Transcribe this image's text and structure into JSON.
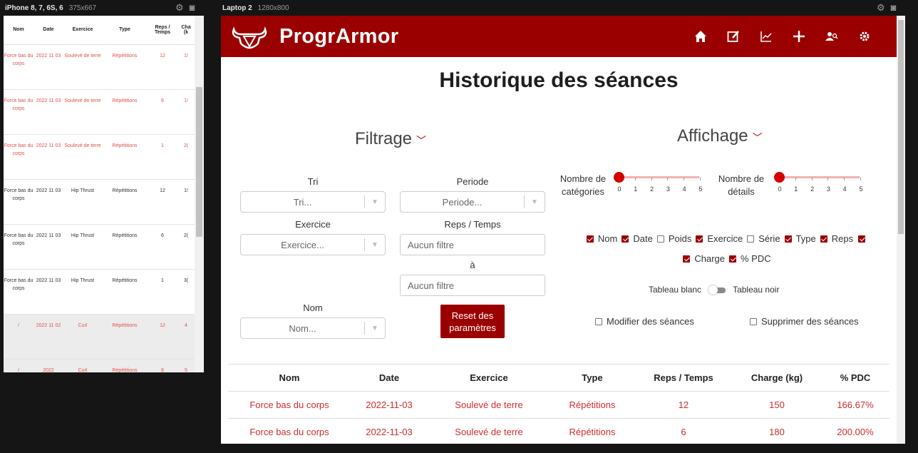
{
  "devtools": {
    "phone_device": "iPhone 8, 7, 6S, 6",
    "phone_size": "375x667",
    "laptop_device": "Laptop 2",
    "laptop_size": "1280x800"
  },
  "phone_table": {
    "headers": [
      "Nom",
      "Date",
      "Exercice",
      "Type",
      "Reps / Temps",
      "Cha (k"
    ],
    "rows": [
      [
        "Force bas du corps",
        "2022 11 03",
        "Soulevé de terre",
        "Répétitions",
        "12",
        "1!"
      ],
      [
        "Force bas du corps",
        "2022 11 03",
        "Soulevé de terre",
        "Répétitions",
        "6",
        "1!"
      ],
      [
        "Force bas du corps",
        "2022 11 03",
        "Soulevé de terre",
        "Répétitions",
        "1",
        "2("
      ],
      [
        "Force bas du corps",
        "2022 11 03",
        "Hip Thrust",
        "Répétitions",
        "12",
        "1!"
      ],
      [
        "Force bas du corps",
        "2022 11 03",
        "Hip Thrust",
        "Répétitions",
        "6",
        "2("
      ],
      [
        "Force bas du corps",
        "2022 11 03",
        "Hip Thrust",
        "Répétitions",
        "1",
        "3("
      ],
      [
        "/",
        "2022 11 02",
        "Curl",
        "Répétitions",
        "12",
        "4"
      ],
      [
        "/",
        "2022",
        "Curl",
        "Répétitions",
        "8",
        "5"
      ]
    ]
  },
  "navbar": {
    "brand": "ProgrArmor",
    "icons": [
      "home-icon",
      "edit-icon",
      "chart-icon",
      "plus-icon",
      "users-icon",
      "gear-icon"
    ]
  },
  "page": {
    "title": "Historique des séances",
    "filtrage": "Filtrage",
    "affichage": "Affichage"
  },
  "filters": {
    "tri_label": "Tri",
    "tri_placeholder": "Tri...",
    "periode_label": "Periode",
    "periode_placeholder": "Periode...",
    "exercice_label": "Exercice",
    "exercice_placeholder": "Exercice...",
    "reps_label": "Reps / Temps",
    "reps_min": "Aucun filtre",
    "a_label": "à",
    "reps_max": "Aucun filtre",
    "nom_label": "Nom",
    "nom_placeholder": "Nom...",
    "reset": "Reset des paramètres"
  },
  "affichage": {
    "categories_label": "Nombre de catégories",
    "details_label": "Nombre de détails",
    "ticks": [
      "0",
      "1",
      "2",
      "3",
      "4",
      "5"
    ],
    "categories_value": 0,
    "details_value": 0,
    "columns": [
      {
        "label": "Nom",
        "checked": true
      },
      {
        "label": "Date",
        "checked": true
      },
      {
        "label": "Poids",
        "checked": false
      },
      {
        "label": "Exercice",
        "checked": true
      },
      {
        "label": "Série",
        "checked": false
      },
      {
        "label": "Type",
        "checked": true
      },
      {
        "label": "Reps",
        "checked": true
      },
      {
        "label": "Charge",
        "checked": true
      },
      {
        "label": "% PDC",
        "checked": true
      }
    ],
    "tableau_blanc": "Tableau blanc",
    "tableau_noir": "Tableau noir",
    "modifier": "Modifier des séances",
    "supprimer": "Supprimer des séances"
  },
  "main_table": {
    "headers": [
      "Nom",
      "Date",
      "Exercice",
      "Type",
      "Reps / Temps",
      "Charge (kg)",
      "% PDC"
    ],
    "rows": [
      [
        "Force bas du corps",
        "2022-11-03",
        "Soulevé de terre",
        "Répétitions",
        "12",
        "150",
        "166.67%"
      ],
      [
        "Force bas du corps",
        "2022-11-03",
        "Soulevé de terre",
        "Répétitions",
        "6",
        "180",
        "200.00%"
      ]
    ]
  }
}
